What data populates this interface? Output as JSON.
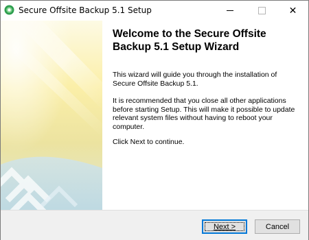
{
  "window": {
    "title": "Secure Offsite Backup 5.1 Setup",
    "icons": {
      "app": "installer-app-icon",
      "minimize": "minimize-icon",
      "maximize": "maximize-icon",
      "close": "close-icon"
    }
  },
  "banner": {
    "image": "setup-wizard-banner-art"
  },
  "main": {
    "heading": "Welcome to the Secure Offsite Backup 5.1 Setup Wizard",
    "paragraph1": "This wizard will guide you through the installation of Secure Offsite Backup 5.1.",
    "paragraph2": "It is recommended that you close all other applications before starting Setup. This will make it possible to update relevant system files without having to reboot your computer.",
    "paragraph3": "Click Next to continue."
  },
  "buttons": {
    "next": "Next >",
    "cancel": "Cancel"
  },
  "colors": {
    "accent": "#0078d7",
    "footer_bg": "#f0f0f0"
  }
}
